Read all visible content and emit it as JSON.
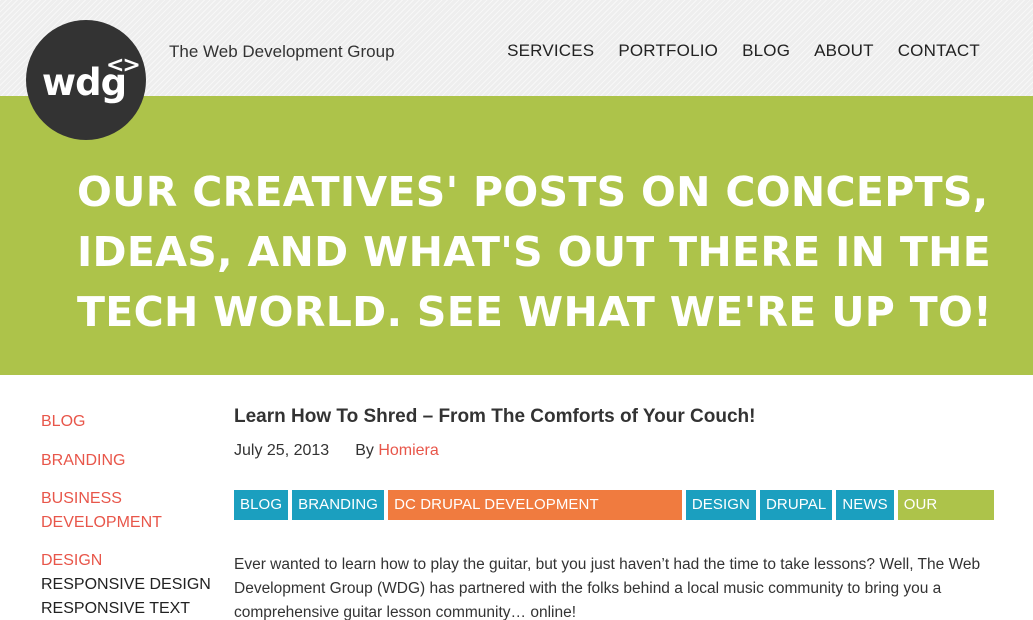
{
  "header": {
    "logo_text": "wdg",
    "logo_mark": "<>",
    "site_name": "The Web Development Group",
    "nav": [
      "SERVICES",
      "PORTFOLIO",
      "BLOG",
      "ABOUT",
      "CONTACT"
    ]
  },
  "hero": {
    "text": "OUR CREATIVES' POSTS ON CONCEPTS, IDEAS, AND WHAT'S OUT THERE IN THE TECH WORLD. SEE WHAT WE'RE UP TO!",
    "background": "#adc34a"
  },
  "sidebar": {
    "links": [
      "BLOG",
      "BRANDING",
      "BUSINESS DEVELOPMENT",
      "DESIGN"
    ],
    "sublinks": [
      "RESPONSIVE DESIGN",
      "RESPONSIVE TEXT"
    ]
  },
  "post": {
    "title": "Learn How To Shred – From The Comforts of Your Couch!",
    "date": "July 25, 2013",
    "by_label": "By",
    "author": "Homiera",
    "tags": [
      {
        "label": "BLOG",
        "color": "#1b9fbf"
      },
      {
        "label": "BRANDING",
        "color": "#1b9fbf"
      },
      {
        "label": "DC DRUPAL DEVELOPMENT COMPANY",
        "color": "#f07b3f"
      },
      {
        "label": "DESIGN",
        "color": "#1b9fbf"
      },
      {
        "label": "DRUPAL",
        "color": "#1b9fbf"
      },
      {
        "label": "NEWS",
        "color": "#1b9fbf"
      },
      {
        "label": "OUR WORK",
        "color": "#adc34a"
      }
    ],
    "excerpt": "Ever wanted to learn how to play the guitar, but you just haven’t had the time to take lessons? Well, The Web Development Group (WDG) has partnered with the folks behind a local music community to bring you a comprehensive guitar lesson community… online!"
  },
  "colors": {
    "accent_red": "#e8564a",
    "tag_blue": "#1b9fbf",
    "tag_orange": "#f07b3f",
    "lime": "#adc34a"
  }
}
